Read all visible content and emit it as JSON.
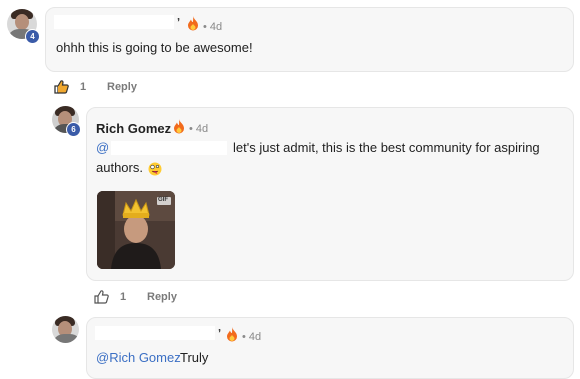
{
  "comments": [
    {
      "level": "4",
      "time": "• 4d",
      "text": "ohhh this is going to be awesome!",
      "like_count": "1",
      "reply_label": "Reply"
    },
    {
      "level": "6",
      "author": "Rich Gomez",
      "time": "• 4d",
      "mention_prefix": "@",
      "text_line1": "let's just admit, this is the best community for aspiring",
      "text_line2": "authors.",
      "emoji_icon": "zany-face-emoji",
      "gif_badge": "GIF",
      "like_count": "1",
      "reply_label": "Reply"
    },
    {
      "time": "• 4d",
      "mention": "@Rich Gomez",
      "text": "Truly"
    }
  ],
  "colors": {
    "mention": "#3b6fc4",
    "level_badge": "#3a5ba8",
    "bubble_bg": "#f7f7f7"
  }
}
